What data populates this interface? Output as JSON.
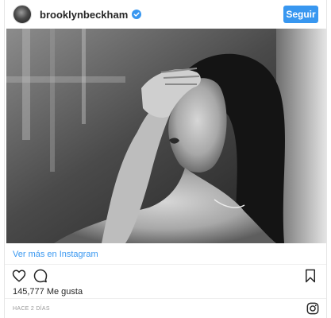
{
  "header": {
    "username": "brooklynbeckham",
    "follow_label": "Seguir",
    "verified_icon": "verified-badge-icon",
    "accent_color": "#3897f0"
  },
  "post": {
    "photo_description_icon": "photo",
    "view_more_label": "Ver más en Instagram"
  },
  "actions": {
    "like_icon": "heart-outline-icon",
    "comment_icon": "comment-bubble-icon",
    "save_icon": "bookmark-icon"
  },
  "likes": {
    "text": "145,777 Me gusta"
  },
  "footer": {
    "timestamp": "HACE 2 DÍAS",
    "logo_icon": "instagram-logo-icon"
  }
}
